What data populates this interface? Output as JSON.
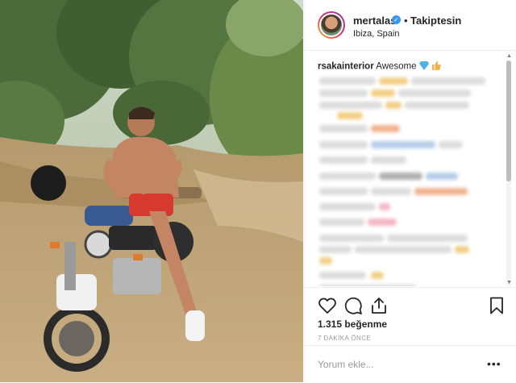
{
  "post": {
    "username": "mertalas",
    "separator": "•",
    "follow_label": "Takiptesin",
    "location": "Ibiza, Spain"
  },
  "comments": {
    "first": {
      "user": "rsakainterior",
      "text": "Awesome"
    }
  },
  "actions": {
    "likes": "1.315 beğenme",
    "timestamp": "7 DAKİKA ÖNCE"
  },
  "add_comment": {
    "placeholder": "Yorum ekle...",
    "more": "•••"
  },
  "colors": {
    "verified": "#3897f0",
    "text": "#262626",
    "muted": "#999999"
  },
  "icons": [
    "verified-badge-icon",
    "heart-icon",
    "comment-icon",
    "share-icon",
    "bookmark-icon",
    "diamond-icon",
    "thumbs-up-icon"
  ]
}
